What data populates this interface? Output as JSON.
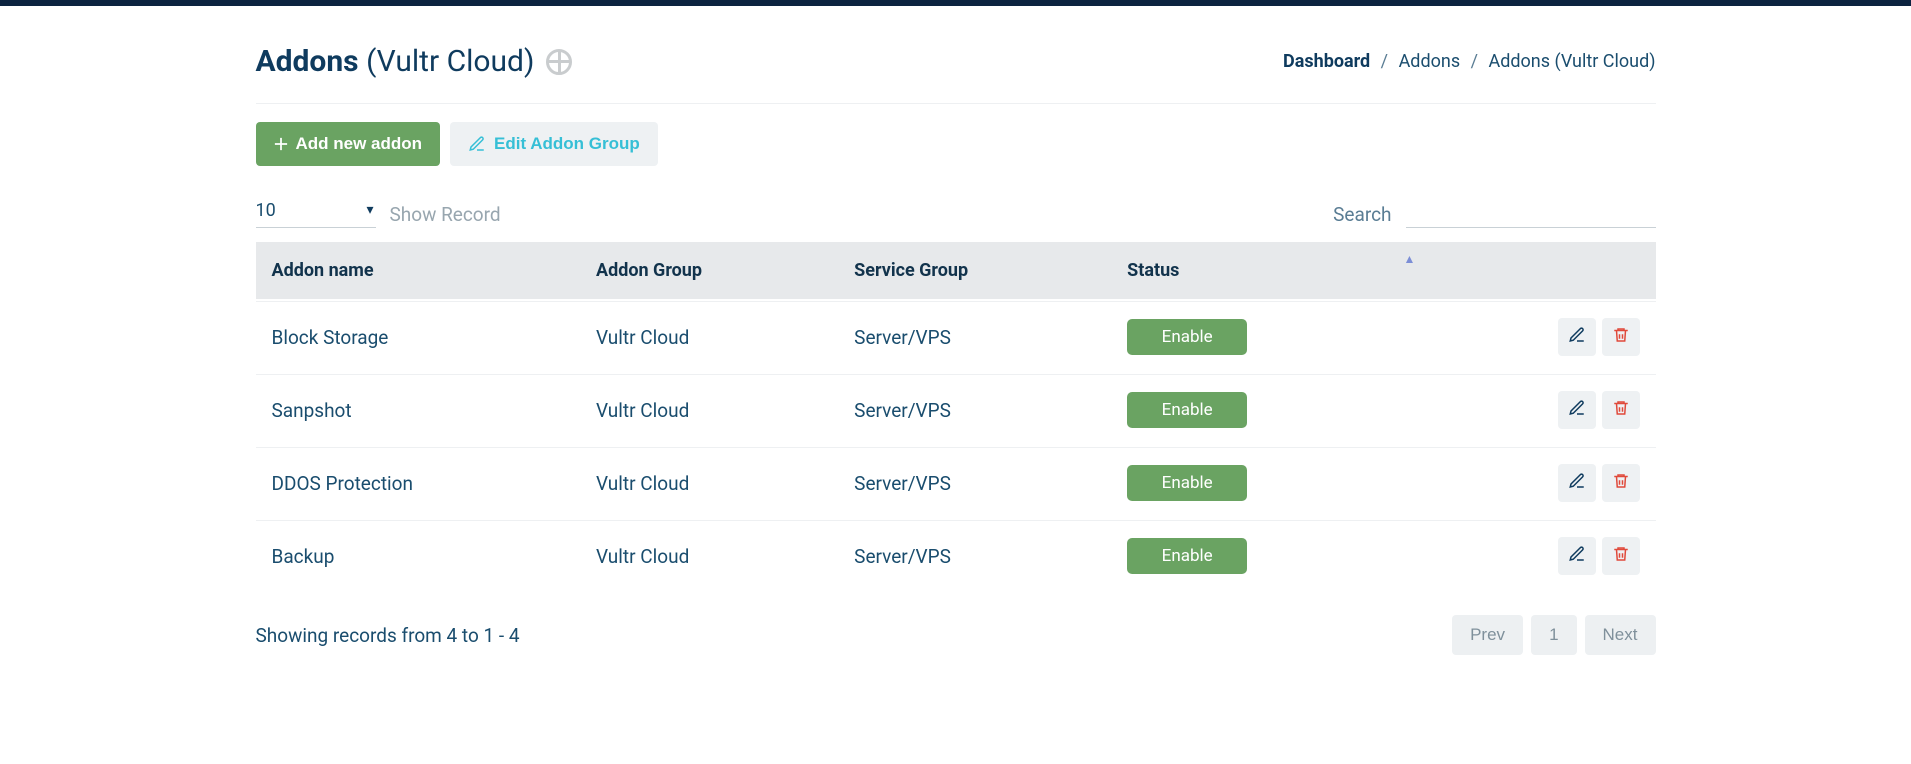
{
  "header": {
    "title_bold": "Addons",
    "title_rest": "(Vultr Cloud)"
  },
  "breadcrumb": {
    "items": [
      "Dashboard",
      "Addons",
      "Addons (Vultr Cloud)"
    ],
    "sep": "/"
  },
  "toolbar": {
    "add_label": "Add new addon",
    "edit_label": "Edit Addon Group"
  },
  "controls": {
    "page_size_value": "10",
    "show_record_label": "Show Record",
    "search_label": "Search"
  },
  "table": {
    "columns": {
      "name": "Addon name",
      "group": "Addon Group",
      "service": "Service Group",
      "status": "Status"
    },
    "rows": [
      {
        "name": "Block Storage",
        "group": "Vultr Cloud",
        "service": "Server/VPS",
        "status": "Enable"
      },
      {
        "name": "Sanpshot",
        "group": "Vultr Cloud",
        "service": "Server/VPS",
        "status": "Enable"
      },
      {
        "name": "DDOS Protection",
        "group": "Vultr Cloud",
        "service": "Server/VPS",
        "status": "Enable"
      },
      {
        "name": "Backup",
        "group": "Vultr Cloud",
        "service": "Server/VPS",
        "status": "Enable"
      }
    ]
  },
  "footer": {
    "showing": "Showing records from 4 to 1 - 4",
    "prev": "Prev",
    "page": "1",
    "next": "Next"
  },
  "colors": {
    "brand_dark": "#0f3b5e",
    "accent_green": "#6aa362",
    "accent_cyan": "#36bfd6",
    "danger": "#e0493a"
  }
}
